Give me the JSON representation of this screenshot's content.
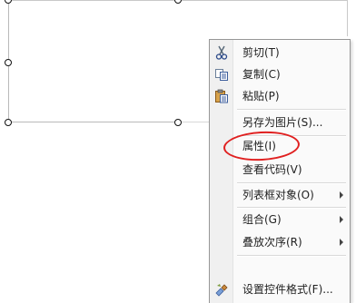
{
  "context_menu": {
    "items": [
      {
        "label": "剪切(T)",
        "icon": "scissors-icon"
      },
      {
        "label": "复制(C)",
        "icon": "copy-icon"
      },
      {
        "label": "粘贴(P)",
        "icon": "paste-icon"
      },
      {
        "label": "另存为图片(S)..."
      },
      {
        "label": "属性(I)"
      },
      {
        "label": "查看代码(V)"
      },
      {
        "label": "列表框对象(O)",
        "submenu": true
      },
      {
        "label": "组合(G)",
        "submenu": true
      },
      {
        "label": "叠放次序(R)",
        "submenu": true
      },
      {
        "label": "设置控件格式(F)...",
        "icon": "format-control-icon"
      }
    ]
  },
  "highlight": {
    "target": "属性(I)",
    "color": "#e02020"
  }
}
